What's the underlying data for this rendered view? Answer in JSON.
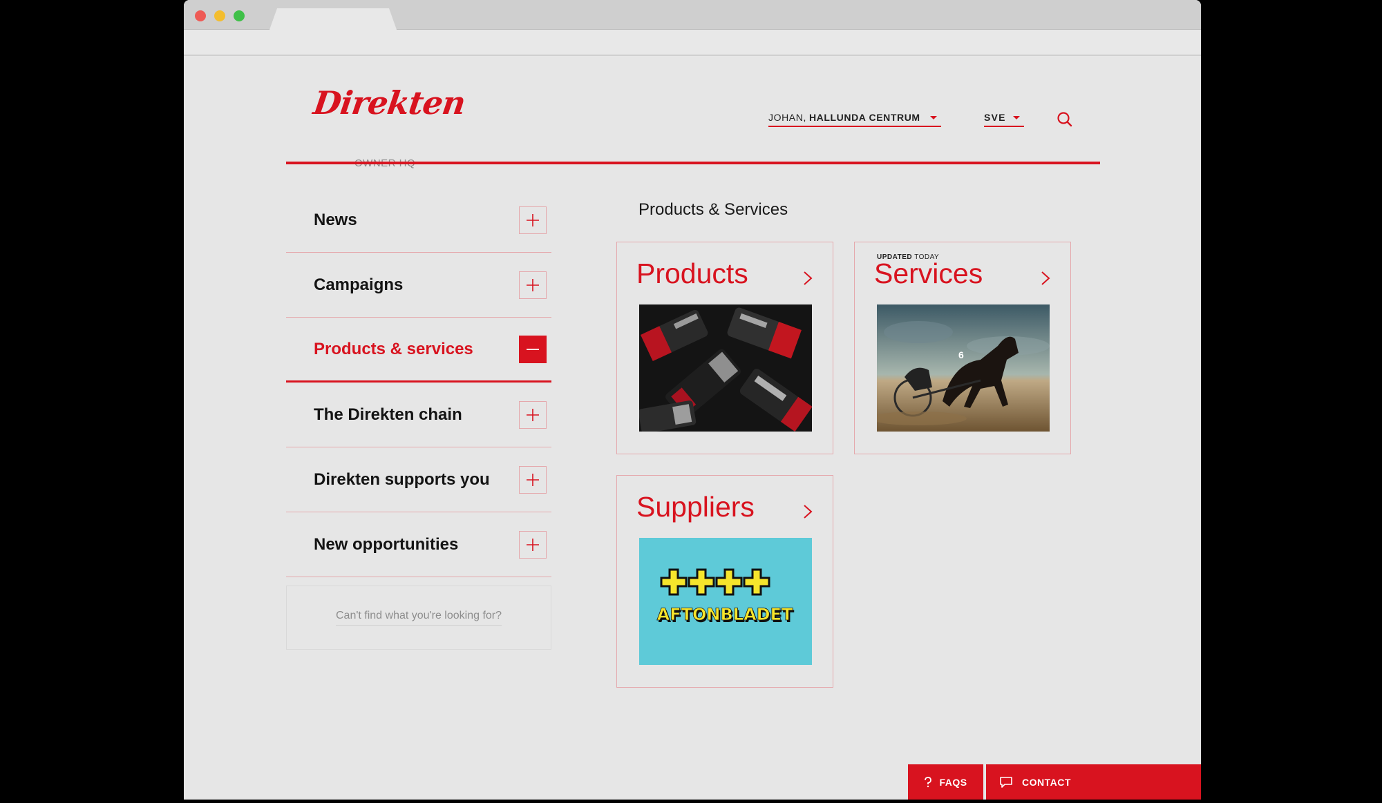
{
  "brand": {
    "name": "Direkten",
    "subtitle": "OWNER HQ",
    "accent": "#d8131f"
  },
  "header": {
    "user_first": "JOHAN,",
    "user_store": "HALLUNDA CENTRUM",
    "language": "SVE",
    "search_icon": "search-icon"
  },
  "sidebar": {
    "items": [
      {
        "label": "News",
        "state": "collapsed"
      },
      {
        "label": "Campaigns",
        "state": "collapsed"
      },
      {
        "label": "Products & services",
        "state": "expanded"
      },
      {
        "label": "The Direkten chain",
        "state": "collapsed"
      },
      {
        "label": "Direkten supports you",
        "state": "collapsed"
      },
      {
        "label": "New opportunities",
        "state": "collapsed"
      }
    ],
    "help_text": "Can't find what you're looking for?"
  },
  "main": {
    "title": "Products & Services",
    "cards": [
      {
        "title": "Products",
        "badge_strong": "",
        "badge_light": ""
      },
      {
        "title": "Services",
        "badge_strong": "UPDATED",
        "badge_light": "TODAY"
      },
      {
        "title": "Suppliers",
        "badge_strong": "",
        "badge_light": "",
        "logo_text": "AFTONBLADET"
      }
    ]
  },
  "footer": {
    "faqs": "FAQS",
    "contact": "CONTACT"
  }
}
